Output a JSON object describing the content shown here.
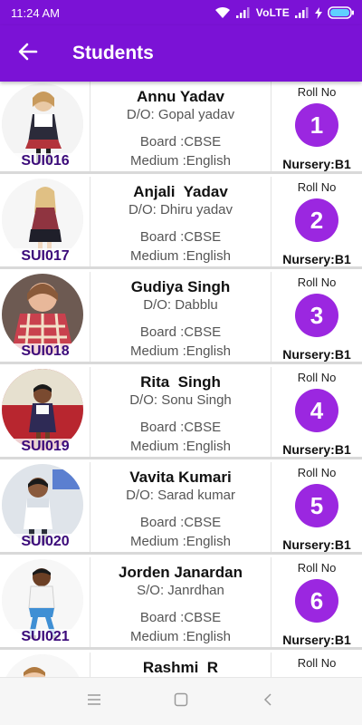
{
  "status_bar": {
    "time": "11:24 AM",
    "network": "VoLTE",
    "icons": [
      "wifi-icon",
      "signal-icon",
      "signal-icon",
      "charging-icon",
      "battery-icon"
    ]
  },
  "app_bar": {
    "title": "Students",
    "back_icon": "arrow-left-icon"
  },
  "colors": {
    "primary": "#7b12d6",
    "roll_circle": "#9b27e0",
    "student_id": "#3b0a7a"
  },
  "students": [
    {
      "name": "Annu Yadav",
      "parent": "D/O: Gopal yadav",
      "board": "Board :CBSE",
      "medium": "Medium :English",
      "id": "SUI016",
      "roll_label": "Roll No",
      "roll": "1",
      "class": "Nursery:B1"
    },
    {
      "name": "Anjali  Yadav",
      "parent": "D/O: Dhiru yadav",
      "board": "Board :CBSE",
      "medium": "Medium :English",
      "id": "SUI017",
      "roll_label": "Roll No",
      "roll": "2",
      "class": "Nursery:B1"
    },
    {
      "name": "Gudiya Singh",
      "parent": "D/O: Dabblu",
      "board": "Board :CBSE",
      "medium": "Medium :English",
      "id": "SUI018",
      "roll_label": "Roll No",
      "roll": "3",
      "class": "Nursery:B1"
    },
    {
      "name": "Rita  Singh",
      "parent": "D/O: Sonu Singh",
      "board": "Board :CBSE",
      "medium": "Medium :English",
      "id": "SUI019",
      "roll_label": "Roll No",
      "roll": "4",
      "class": "Nursery:B1"
    },
    {
      "name": "Vavita Kumari",
      "parent": "D/O: Sarad kumar",
      "board": "Board :CBSE",
      "medium": "Medium :English",
      "id": "SUI020",
      "roll_label": "Roll No",
      "roll": "5",
      "class": "Nursery:B1"
    },
    {
      "name": "Jorden Janardan",
      "parent": "S/O: Janrdhan",
      "board": "Board :CBSE",
      "medium": "Medium :English",
      "id": "SUI021",
      "roll_label": "Roll No",
      "roll": "6",
      "class": "Nursery:B1"
    },
    {
      "name": "Rashmi  R",
      "roll_label": "Roll No"
    }
  ],
  "nav_bar": {
    "icons": [
      "menu-icon",
      "home-square-icon",
      "back-chevron-icon"
    ]
  }
}
